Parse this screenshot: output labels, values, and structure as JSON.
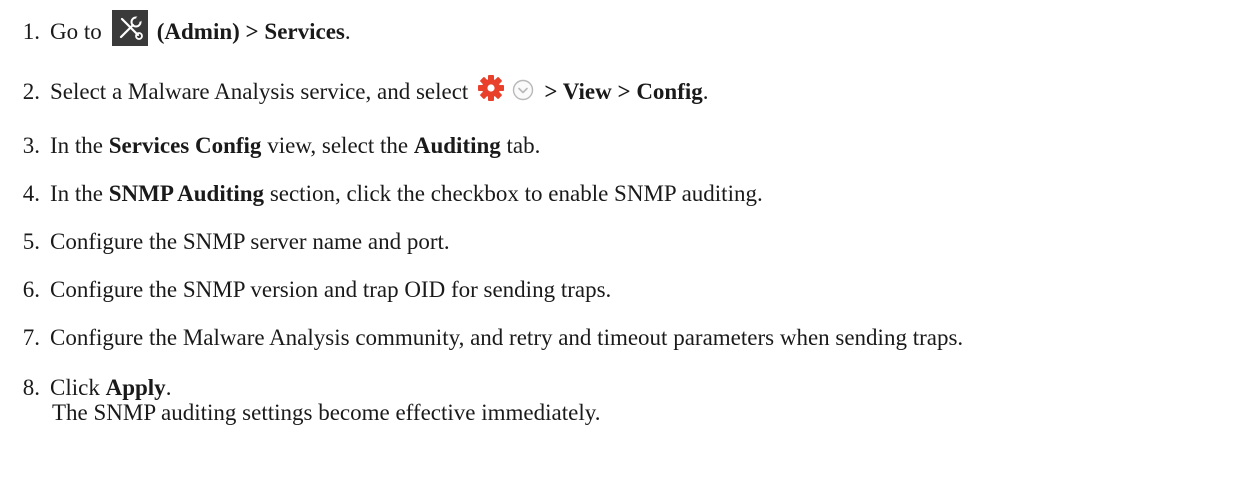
{
  "steps": [
    {
      "num": "1.",
      "pre": "Go to",
      "bold": "(Admin) > Services",
      "post": ".",
      "icons": [
        "admin-tools-icon"
      ]
    },
    {
      "num": "2.",
      "pre": "Select a Malware Analysis service, and select",
      "bold": "> View > Config",
      "post": ".",
      "icons": [
        "gear-icon",
        "chevron-down-icon"
      ]
    },
    {
      "num": "3.",
      "parts": [
        "In the ",
        "Services Config",
        " view, select the ",
        "Auditing",
        " tab."
      ]
    },
    {
      "num": "4.",
      "parts": [
        "In the ",
        "SNMP Auditing",
        " section, click the checkbox to enable SNMP auditing."
      ]
    },
    {
      "num": "5.",
      "text": "Configure the SNMP server name and port."
    },
    {
      "num": "6.",
      "text": "Configure the SNMP version and trap OID for sending traps."
    },
    {
      "num": "7.",
      "text": "Configure the Malware Analysis community, and retry and timeout parameters when sending traps."
    },
    {
      "num": "8.",
      "pre": "Click ",
      "bold": "Apply",
      "post": "."
    }
  ],
  "note": "The SNMP auditing settings become effective immediately.",
  "colors": {
    "gear": "#e8402a",
    "admin_icon_bg": "#3a3a3a",
    "chevron": "#b8b8b8"
  }
}
